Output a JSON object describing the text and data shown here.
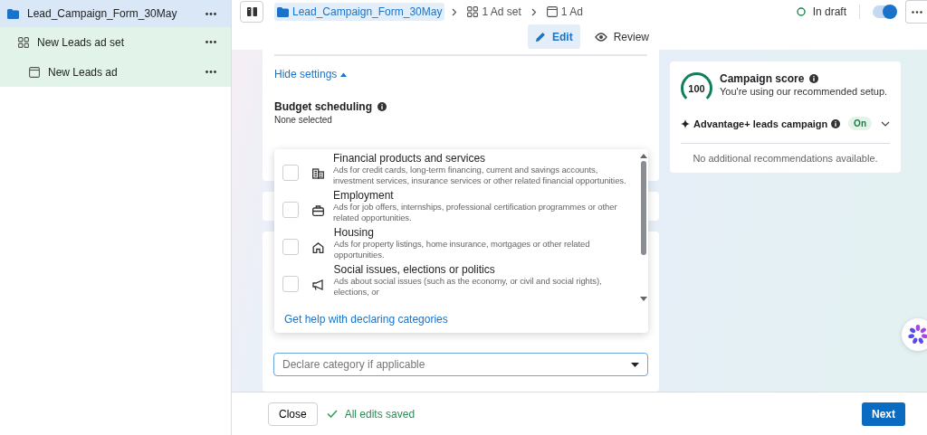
{
  "sidebar": {
    "items": [
      {
        "kind": "campaign",
        "label": "Lead_Campaign_Form_30May",
        "selected": true,
        "children": [
          {
            "kind": "adset",
            "label": "New Leads ad set",
            "selected": false,
            "children": [
              {
                "kind": "ad",
                "label": "New Leads ad",
                "selected": false
              }
            ]
          }
        ]
      }
    ]
  },
  "topbar": {
    "breadcrumbs": [
      {
        "kind": "campaign",
        "label": "Lead_Campaign_Form_30May",
        "selected": true
      },
      {
        "kind": "adset",
        "label": "1 Ad set",
        "selected": false
      },
      {
        "kind": "ad",
        "label": "1 Ad",
        "selected": false
      }
    ],
    "status": "In draft",
    "toggle": {
      "on": true
    }
  },
  "tabs": [
    {
      "kind": "edit",
      "label": "Edit",
      "selected": true
    },
    {
      "kind": "review",
      "label": "Review",
      "selected": false
    }
  ],
  "form": {
    "hide_settings_link": "Hide settings",
    "budget_scheduling": {
      "label": "Budget scheduling",
      "value": "None selected"
    },
    "category_dropdown": {
      "options": [
        {
          "kind": "finance",
          "title": "Financial products and services",
          "description": "Ads for credit cards, long-term financing, current and savings accounts, investment services, insurance services or other related financial opportunities.",
          "checked": false
        },
        {
          "kind": "employment",
          "title": "Employment",
          "description": "Ads for job offers, internships, professional certification programmes or other related opportunities.",
          "checked": false
        },
        {
          "kind": "housing",
          "title": "Housing",
          "description": "Ads for property listings, home insurance, mortgages or other related opportunities.",
          "checked": false
        },
        {
          "kind": "politics",
          "title": "Social issues, elections or politics",
          "description": "Ads about social issues (such as the economy, or civil and social rights), elections, or",
          "checked": false
        }
      ],
      "help_link": "Get help with declaring categories"
    },
    "category_select": {
      "placeholder": "Declare category if applicable"
    }
  },
  "score_card": {
    "score": "100",
    "title": "Campaign score",
    "subtitle": "You're using our recommended setup.",
    "advantage": {
      "label": "Advantage+ leads campaign",
      "badge": "On"
    },
    "note": "No additional recommendations available."
  },
  "footer": {
    "close": "Close",
    "saved": "All edits saved",
    "next": "Next"
  }
}
